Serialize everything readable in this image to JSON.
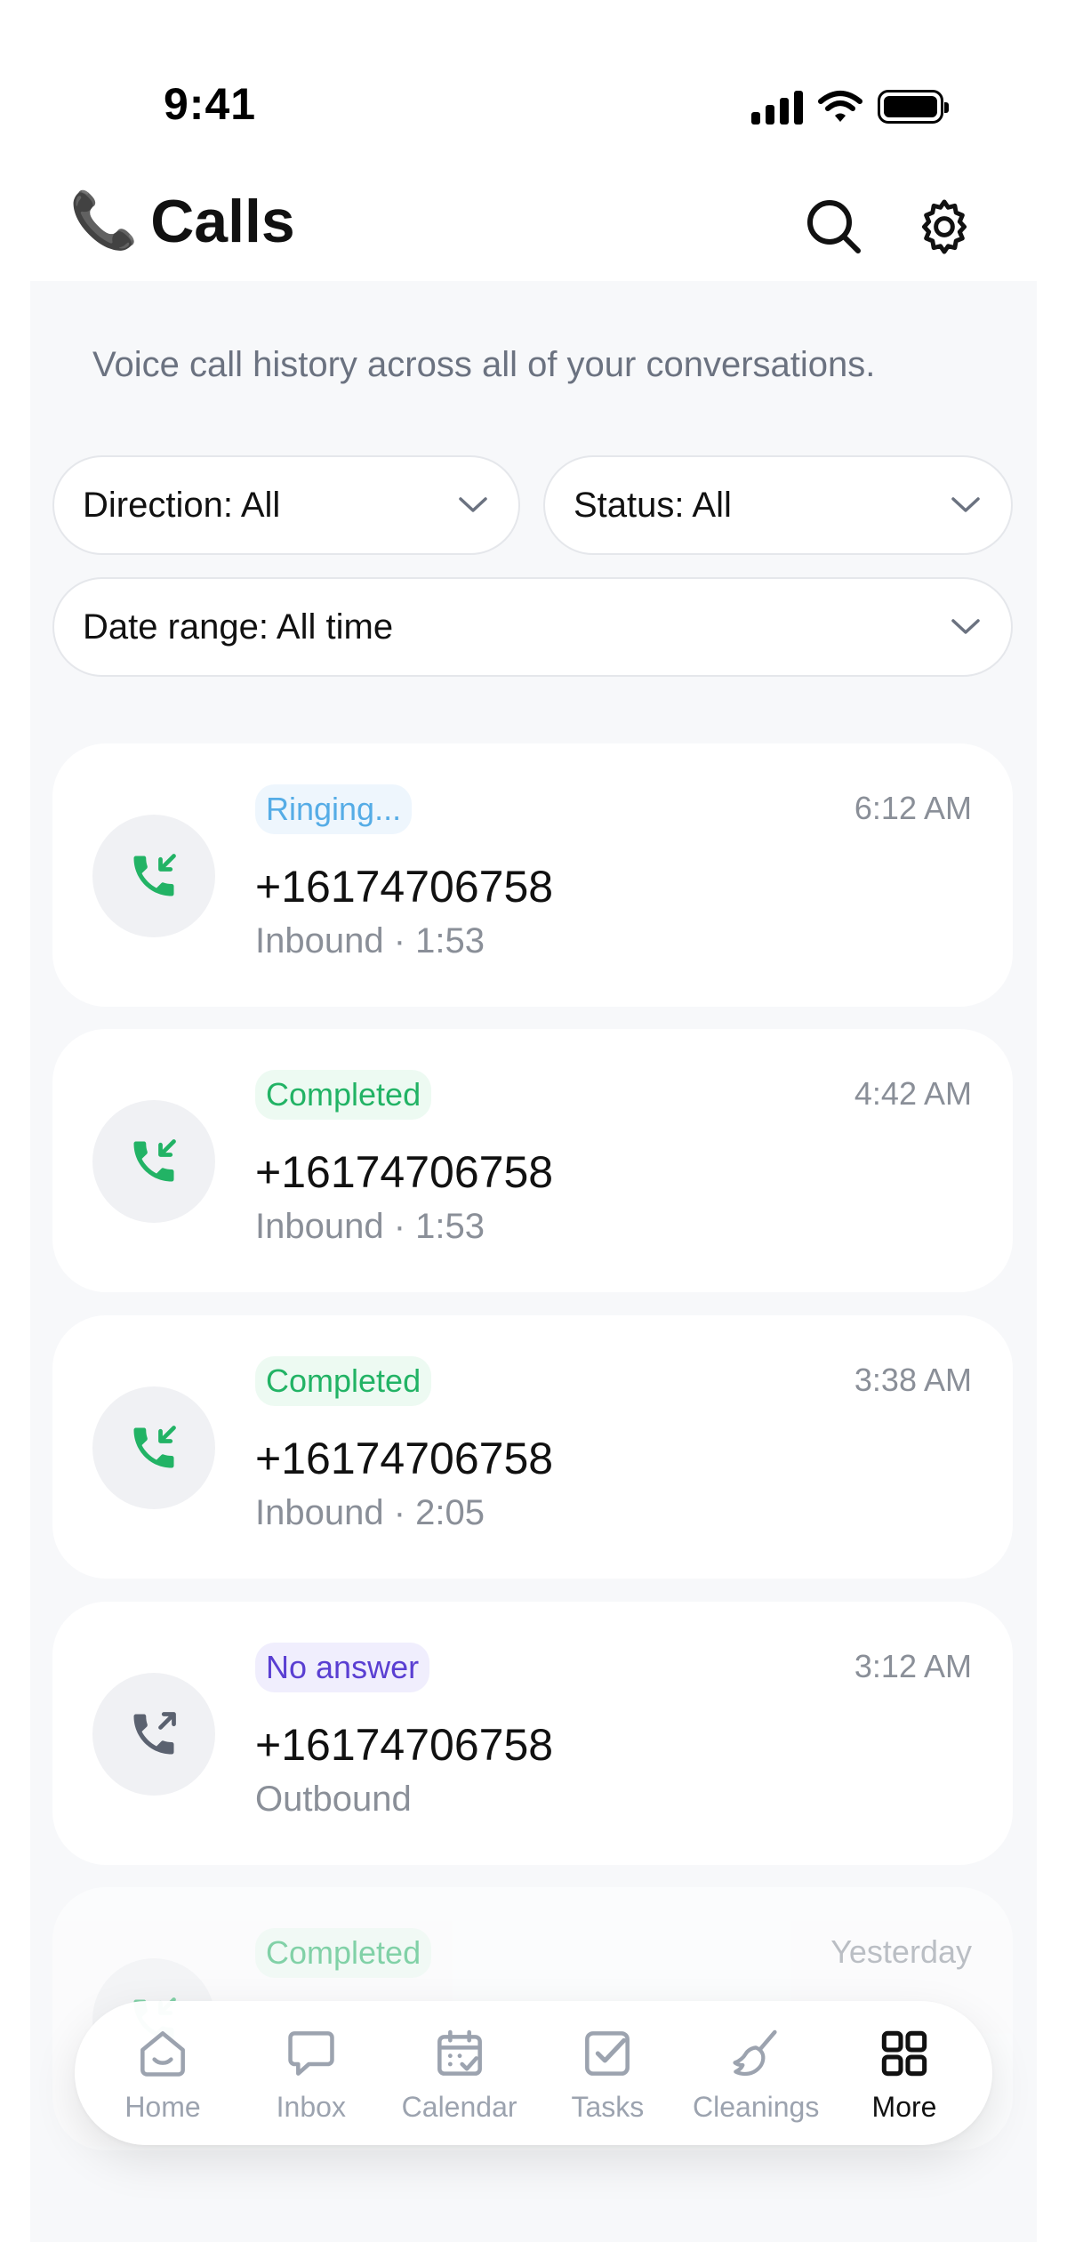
{
  "status_bar": {
    "time": "9:41"
  },
  "header": {
    "title_emoji": "📞",
    "title": "Calls"
  },
  "description": "Voice call history across all of your conversations.",
  "filters": {
    "direction": "Direction: All",
    "status": "Status: All",
    "date_range": "Date range: All time"
  },
  "calls": [
    {
      "status": "Ringing...",
      "status_type": "ringing",
      "time": "6:12 AM",
      "number": "+16174706758",
      "detail": "Inbound · 1:53",
      "direction": "inbound",
      "icon": "phone-incoming-icon",
      "icon_color": "#22b365"
    },
    {
      "status": "Completed",
      "status_type": "completed",
      "time": "4:42 AM",
      "number": "+16174706758",
      "detail": "Inbound · 1:53",
      "direction": "inbound",
      "icon": "phone-incoming-icon",
      "icon_color": "#22b365"
    },
    {
      "status": "Completed",
      "status_type": "completed",
      "time": "3:38 AM",
      "number": "+16174706758",
      "detail": "Inbound · 2:05",
      "direction": "inbound",
      "icon": "phone-incoming-icon",
      "icon_color": "#22b365"
    },
    {
      "status": "No answer",
      "status_type": "noanswer",
      "time": "3:12 AM",
      "number": "+16174706758",
      "detail": "Outbound",
      "direction": "outbound",
      "icon": "phone-outgoing-icon",
      "icon_color": "#5b6270"
    },
    {
      "status": "Completed",
      "status_type": "completed",
      "time": "Yesterday",
      "direction": "inbound",
      "icon": "phone-incoming-icon",
      "icon_color": "#22b365"
    }
  ],
  "nav": [
    {
      "label": "Home",
      "icon": "home-icon",
      "active": false
    },
    {
      "label": "Inbox",
      "icon": "inbox-icon",
      "active": false
    },
    {
      "label": "Calendar",
      "icon": "calendar-icon",
      "active": false
    },
    {
      "label": "Tasks",
      "icon": "tasks-icon",
      "active": false
    },
    {
      "label": "Cleanings",
      "icon": "broom-icon",
      "active": false
    },
    {
      "label": "More",
      "icon": "grid-icon",
      "active": true
    }
  ],
  "colors": {
    "completed": "#22b365",
    "ringing": "#55ace6",
    "no_answer": "#5a3fd2",
    "background": "#f7f8fa"
  }
}
